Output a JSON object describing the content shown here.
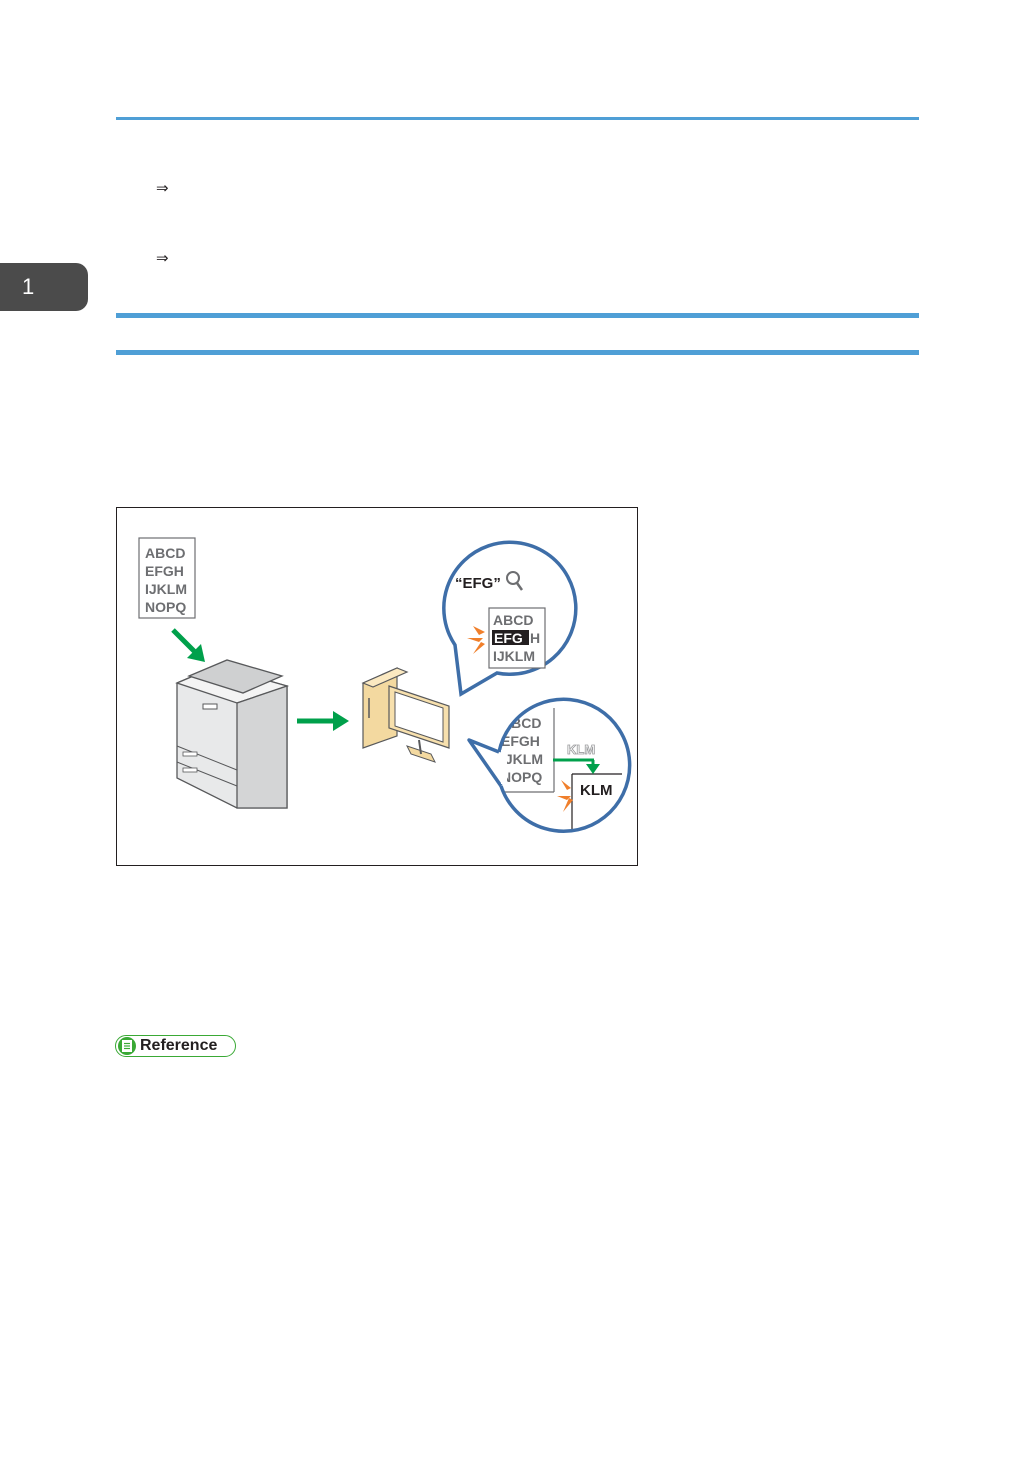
{
  "chapter_tab": {
    "number": "1"
  },
  "arrows": {
    "first": "⇒",
    "second": "⇒"
  },
  "figure": {
    "source_document": [
      "ABCD",
      "EFGH",
      "IJKLM",
      "NOPQ"
    ],
    "search_bubble": {
      "query": "“EFG”",
      "lines": [
        "ABCD",
        "EFG",
        "H",
        "IJKLM"
      ]
    },
    "copy_bubble": {
      "lines": [
        "ABCD",
        "EFGH",
        "IJKLM",
        "NOPQ"
      ],
      "ghost_text": "KLM",
      "pasted_text": "KLM"
    }
  },
  "reference": {
    "label": "Reference"
  },
  "colors": {
    "accent_blue": "#4f9fd6",
    "green": "#00a04b",
    "bubble_blue": "#3e6ea8",
    "orange": "#f07f2b"
  }
}
